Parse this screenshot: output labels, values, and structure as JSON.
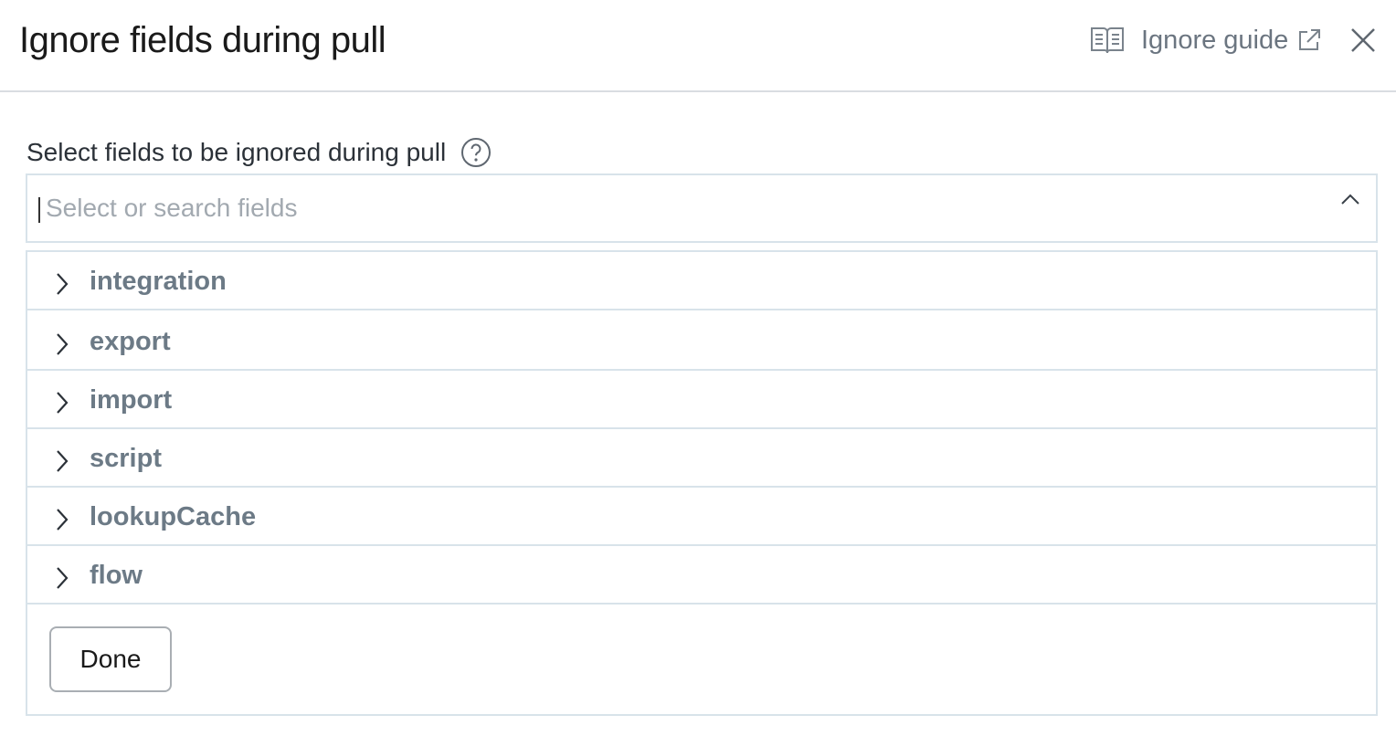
{
  "dialog": {
    "title": "Ignore fields during pull",
    "guide_link_label": "Ignore guide",
    "icons": {
      "guide": "book-icon",
      "external": "external-link-icon",
      "close": "close-icon"
    }
  },
  "field": {
    "label": "Select fields to be ignored during pull",
    "help_icon": "question-circle-icon",
    "placeholder": "Select or search fields",
    "value": "",
    "toggle_icon": "chevron-up-icon"
  },
  "tree": {
    "items": [
      {
        "label": "integration",
        "icon": "chevron-right-icon"
      },
      {
        "label": "export",
        "icon": "chevron-right-icon"
      },
      {
        "label": "import",
        "icon": "chevron-right-icon"
      },
      {
        "label": "script",
        "icon": "chevron-right-icon"
      },
      {
        "label": "lookupCache",
        "icon": "chevron-right-icon"
      },
      {
        "label": "flow",
        "icon": "chevron-right-icon"
      }
    ]
  },
  "actions": {
    "done_label": "Done"
  },
  "colors": {
    "border": "#d8e3ea",
    "item_text": "#6c7a86",
    "placeholder": "#a2a9b0"
  }
}
